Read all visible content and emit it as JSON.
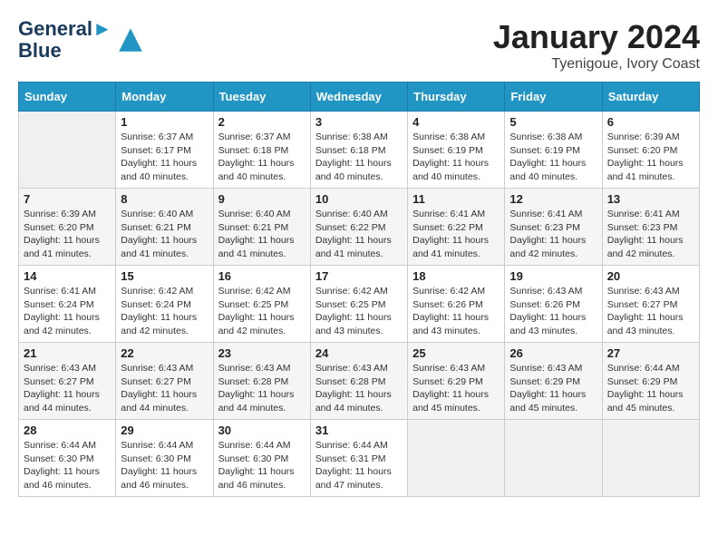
{
  "header": {
    "logo_line1": "General",
    "logo_line2": "Blue",
    "month_title": "January 2024",
    "subtitle": "Tyenigoue, Ivory Coast"
  },
  "days_of_week": [
    "Sunday",
    "Monday",
    "Tuesday",
    "Wednesday",
    "Thursday",
    "Friday",
    "Saturday"
  ],
  "weeks": [
    [
      {
        "day": "",
        "info": ""
      },
      {
        "day": "1",
        "info": "Sunrise: 6:37 AM\nSunset: 6:17 PM\nDaylight: 11 hours and 40 minutes."
      },
      {
        "day": "2",
        "info": "Sunrise: 6:37 AM\nSunset: 6:18 PM\nDaylight: 11 hours and 40 minutes."
      },
      {
        "day": "3",
        "info": "Sunrise: 6:38 AM\nSunset: 6:18 PM\nDaylight: 11 hours and 40 minutes."
      },
      {
        "day": "4",
        "info": "Sunrise: 6:38 AM\nSunset: 6:19 PM\nDaylight: 11 hours and 40 minutes."
      },
      {
        "day": "5",
        "info": "Sunrise: 6:38 AM\nSunset: 6:19 PM\nDaylight: 11 hours and 40 minutes."
      },
      {
        "day": "6",
        "info": "Sunrise: 6:39 AM\nSunset: 6:20 PM\nDaylight: 11 hours and 41 minutes."
      }
    ],
    [
      {
        "day": "7",
        "info": "Sunrise: 6:39 AM\nSunset: 6:20 PM\nDaylight: 11 hours and 41 minutes."
      },
      {
        "day": "8",
        "info": "Sunrise: 6:40 AM\nSunset: 6:21 PM\nDaylight: 11 hours and 41 minutes."
      },
      {
        "day": "9",
        "info": "Sunrise: 6:40 AM\nSunset: 6:21 PM\nDaylight: 11 hours and 41 minutes."
      },
      {
        "day": "10",
        "info": "Sunrise: 6:40 AM\nSunset: 6:22 PM\nDaylight: 11 hours and 41 minutes."
      },
      {
        "day": "11",
        "info": "Sunrise: 6:41 AM\nSunset: 6:22 PM\nDaylight: 11 hours and 41 minutes."
      },
      {
        "day": "12",
        "info": "Sunrise: 6:41 AM\nSunset: 6:23 PM\nDaylight: 11 hours and 42 minutes."
      },
      {
        "day": "13",
        "info": "Sunrise: 6:41 AM\nSunset: 6:23 PM\nDaylight: 11 hours and 42 minutes."
      }
    ],
    [
      {
        "day": "14",
        "info": "Sunrise: 6:41 AM\nSunset: 6:24 PM\nDaylight: 11 hours and 42 minutes."
      },
      {
        "day": "15",
        "info": "Sunrise: 6:42 AM\nSunset: 6:24 PM\nDaylight: 11 hours and 42 minutes."
      },
      {
        "day": "16",
        "info": "Sunrise: 6:42 AM\nSunset: 6:25 PM\nDaylight: 11 hours and 42 minutes."
      },
      {
        "day": "17",
        "info": "Sunrise: 6:42 AM\nSunset: 6:25 PM\nDaylight: 11 hours and 43 minutes."
      },
      {
        "day": "18",
        "info": "Sunrise: 6:42 AM\nSunset: 6:26 PM\nDaylight: 11 hours and 43 minutes."
      },
      {
        "day": "19",
        "info": "Sunrise: 6:43 AM\nSunset: 6:26 PM\nDaylight: 11 hours and 43 minutes."
      },
      {
        "day": "20",
        "info": "Sunrise: 6:43 AM\nSunset: 6:27 PM\nDaylight: 11 hours and 43 minutes."
      }
    ],
    [
      {
        "day": "21",
        "info": "Sunrise: 6:43 AM\nSunset: 6:27 PM\nDaylight: 11 hours and 44 minutes."
      },
      {
        "day": "22",
        "info": "Sunrise: 6:43 AM\nSunset: 6:27 PM\nDaylight: 11 hours and 44 minutes."
      },
      {
        "day": "23",
        "info": "Sunrise: 6:43 AM\nSunset: 6:28 PM\nDaylight: 11 hours and 44 minutes."
      },
      {
        "day": "24",
        "info": "Sunrise: 6:43 AM\nSunset: 6:28 PM\nDaylight: 11 hours and 44 minutes."
      },
      {
        "day": "25",
        "info": "Sunrise: 6:43 AM\nSunset: 6:29 PM\nDaylight: 11 hours and 45 minutes."
      },
      {
        "day": "26",
        "info": "Sunrise: 6:43 AM\nSunset: 6:29 PM\nDaylight: 11 hours and 45 minutes."
      },
      {
        "day": "27",
        "info": "Sunrise: 6:44 AM\nSunset: 6:29 PM\nDaylight: 11 hours and 45 minutes."
      }
    ],
    [
      {
        "day": "28",
        "info": "Sunrise: 6:44 AM\nSunset: 6:30 PM\nDaylight: 11 hours and 46 minutes."
      },
      {
        "day": "29",
        "info": "Sunrise: 6:44 AM\nSunset: 6:30 PM\nDaylight: 11 hours and 46 minutes."
      },
      {
        "day": "30",
        "info": "Sunrise: 6:44 AM\nSunset: 6:30 PM\nDaylight: 11 hours and 46 minutes."
      },
      {
        "day": "31",
        "info": "Sunrise: 6:44 AM\nSunset: 6:31 PM\nDaylight: 11 hours and 47 minutes."
      },
      {
        "day": "",
        "info": ""
      },
      {
        "day": "",
        "info": ""
      },
      {
        "day": "",
        "info": ""
      }
    ]
  ]
}
